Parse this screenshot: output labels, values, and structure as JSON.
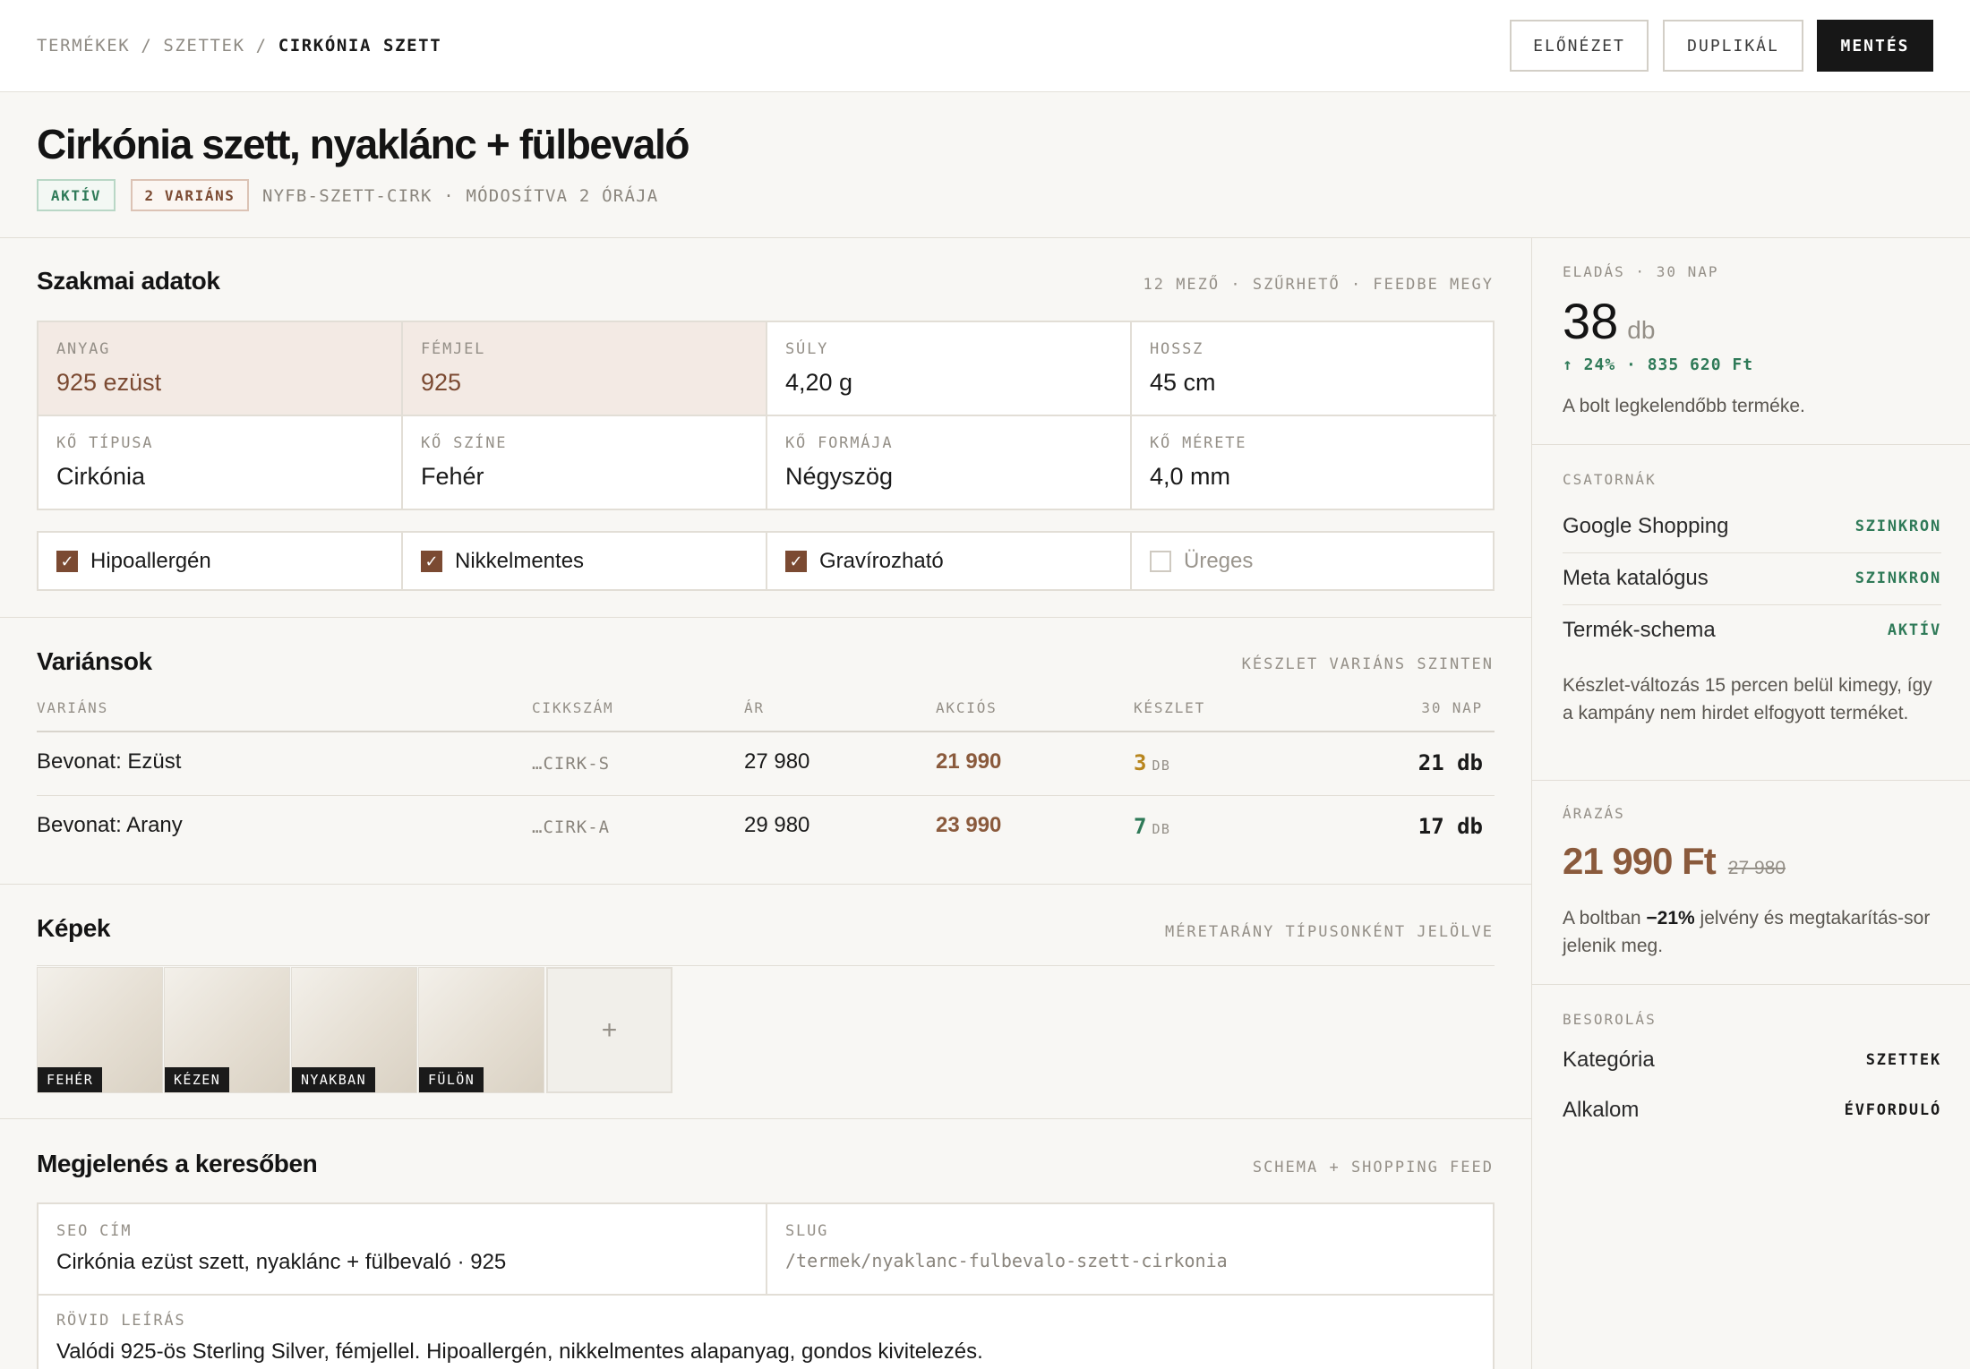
{
  "breadcrumb": {
    "items": [
      "TERMÉKEK",
      "SZETTEK"
    ],
    "current": "CIRKÓNIA SZETT",
    "separator": "/"
  },
  "actions": {
    "preview": "ELŐNÉZET",
    "duplicate": "DUPLIKÁL",
    "save": "MENTÉS"
  },
  "product": {
    "title": "Cirkónia szett, nyaklánc + fülbevaló",
    "status_badge": "AKTÍV",
    "variant_badge": "2 VARIÁNS",
    "meta": "NYFB-SZETT-CIRK · MÓDOSÍTVA 2 ÓRÁJA"
  },
  "specs": {
    "title": "Szakmai adatok",
    "meta": "12 MEZŐ · SZŰRHETŐ · FEEDBE MEGY",
    "fields": [
      {
        "label": "ANYAG",
        "value": "925 ezüst"
      },
      {
        "label": "FÉMJEL",
        "value": "925"
      },
      {
        "label": "SÚLY",
        "value": "4,20 g"
      },
      {
        "label": "HOSSZ",
        "value": "45 cm"
      },
      {
        "label": "KŐ TÍPUSA",
        "value": "Cirkónia"
      },
      {
        "label": "KŐ SZÍNE",
        "value": "Fehér"
      },
      {
        "label": "KŐ FORMÁJA",
        "value": "Négyszög"
      },
      {
        "label": "KŐ MÉRETE",
        "value": "4,0 mm"
      }
    ],
    "flags": [
      {
        "label": "Hipoallergén",
        "checked": true
      },
      {
        "label": "Nikkelmentes",
        "checked": true
      },
      {
        "label": "Gravírozható",
        "checked": true
      },
      {
        "label": "Üreges",
        "checked": false
      }
    ],
    "checkmark": "✓"
  },
  "variants": {
    "title": "Variánsok",
    "meta": "KÉSZLET VARIÁNS SZINTEN",
    "columns": [
      "VARIÁNS",
      "CIKKSZÁM",
      "ÁR",
      "AKCIÓS",
      "KÉSZLET",
      "30 NAP"
    ],
    "rows": [
      {
        "name": "Bevonat: Ezüst",
        "sku": "…CIRK-S",
        "price": "27 980",
        "sale": "21 990",
        "stock": "3",
        "stock_unit": "DB",
        "sold": "21 db"
      },
      {
        "name": "Bevonat: Arany",
        "sku": "…CIRK-A",
        "price": "29 980",
        "sale": "23 990",
        "stock": "7",
        "stock_unit": "DB",
        "sold": "17 db"
      }
    ],
    "colors": {
      "low_stock": "#b8861f",
      "ok_stock": "#2f7a58"
    }
  },
  "images": {
    "title": "Képek",
    "meta": "MÉRETARÁNY TÍPUSONKÉNT JELÖLVE",
    "items": [
      {
        "tag": "FEHÉR"
      },
      {
        "tag": "KÉZEN"
      },
      {
        "tag": "NYAKBAN"
      },
      {
        "tag": "FÜLÖN"
      }
    ],
    "add_label": "+"
  },
  "seo": {
    "title": "Megjelenés a keresőben",
    "meta": "SCHEMA + SHOPPING FEED",
    "seo_title_label": "SEO CÍM",
    "seo_title": "Cirkónia ezüst szett, nyaklánc + fülbevaló · 925",
    "slug_label": "SLUG",
    "slug": "/termek/nyaklanc-fulbevalo-szett-cirkonia",
    "desc_label": "RÖVID LEÍRÁS",
    "desc": "Valódi 925-ös Sterling Silver, fémjellel. Hipoallergén, nikkelmentes alapanyag, gondos kivitelezés."
  },
  "sidebar": {
    "sales": {
      "label": "ELADÁS · 30 NAP",
      "value": "38",
      "unit": "db",
      "trend": "↑ 24% · 835 620 Ft",
      "note": "A bolt legkelendőbb terméke."
    },
    "channels": {
      "label": "CSATORNÁK",
      "items": [
        {
          "name": "Google Shopping",
          "status": "SZINKRON"
        },
        {
          "name": "Meta katalógus",
          "status": "SZINKRON"
        },
        {
          "name": "Termék-schema",
          "status": "AKTÍV"
        }
      ],
      "note": "Készlet-változás 15 percen belül kimegy, így a kampány nem hirdet elfogyott terméket."
    },
    "pricing": {
      "label": "ÁRAZÁS",
      "price": "21 990 Ft",
      "old_price": "27 980",
      "note_before": "A boltban ",
      "note_bold": "−21%",
      "note_after": " jelvény és megtakarítás-sor jelenik meg."
    },
    "classification": {
      "label": "BESOROLÁS",
      "items": [
        {
          "name": "Kategória",
          "value": "SZETTEK"
        },
        {
          "name": "Alkalom",
          "value": "ÉVFORDULÓ"
        }
      ]
    }
  }
}
